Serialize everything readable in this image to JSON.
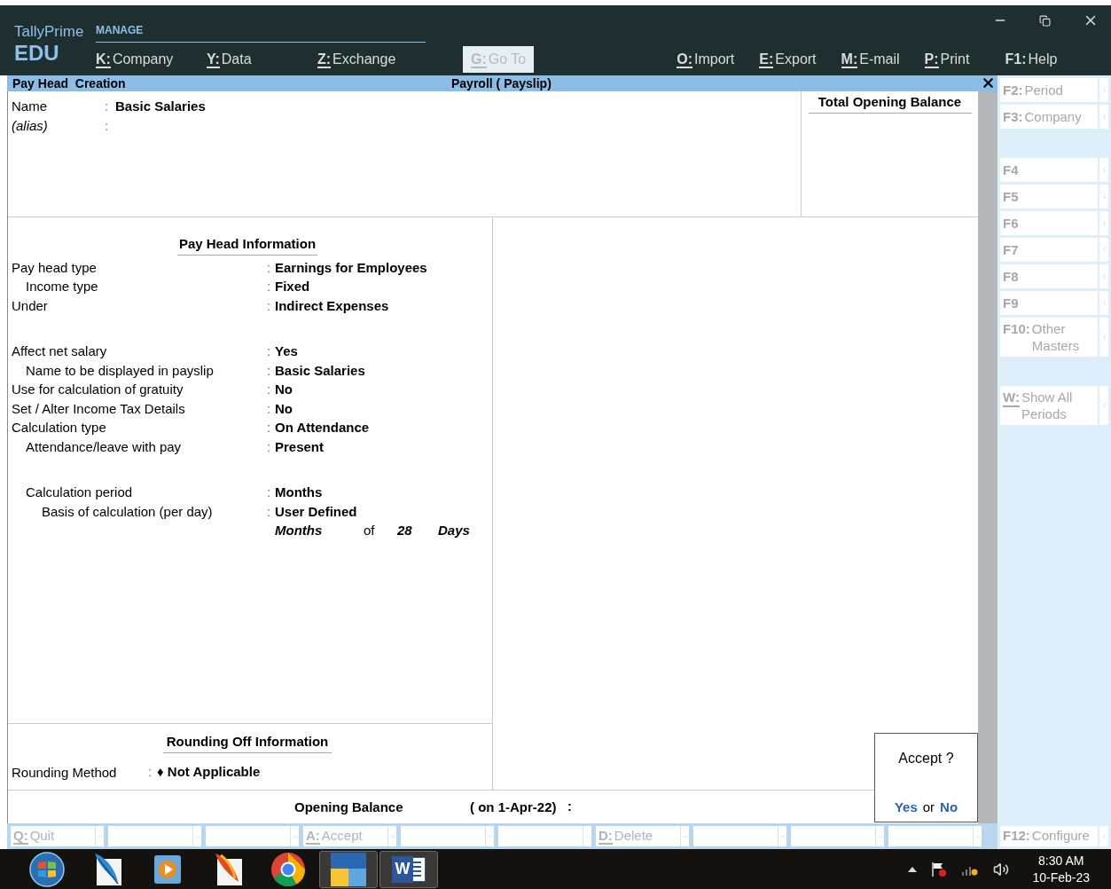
{
  "key_separator": ":",
  "header": {
    "product": "TallyPrime",
    "edition": "EDU",
    "section": "MANAGE",
    "menu_left": [
      {
        "key": "K",
        "label": "Company",
        "underlined": true,
        "disabled": false
      },
      {
        "key": "Y",
        "label": "Data",
        "underlined": true,
        "disabled": false
      },
      {
        "key": "Z",
        "label": "Exchange",
        "underlined": true,
        "disabled": false
      },
      {
        "key": "G",
        "label": "Go To",
        "underlined": true,
        "disabled": true
      }
    ],
    "menu_right": [
      {
        "key": "O",
        "label": "Import",
        "underlined": true,
        "disabled": false
      },
      {
        "key": "E",
        "label": "Export",
        "underlined": true,
        "disabled": false
      },
      {
        "key": "M",
        "label": "E-mail",
        "underlined": true,
        "disabled": false
      },
      {
        "key": "P",
        "label": "Print",
        "underlined": true,
        "disabled": false
      }
    ],
    "help": {
      "key": "F1",
      "label": "Help",
      "underlined": false
    }
  },
  "title_bar": {
    "left": "Pay Head  Creation",
    "center": "Payroll ( Payslip)"
  },
  "master": {
    "fields": [
      {
        "label": "Name",
        "value": "Basic Salaries",
        "italic": false
      },
      {
        "label": "(alias)",
        "italic": true
      }
    ],
    "colon": ":",
    "total_title": "Total Opening Balance"
  },
  "pay_head_info": {
    "title": "Pay Head Information",
    "rows": [
      {
        "label": "Pay head type",
        "value": "Earnings for Employees",
        "gap_before": false,
        "children": [
          {
            "label": "Income type",
            "value": "Fixed",
            "gap_before": false
          }
        ]
      },
      {
        "label": "Under",
        "value": "Indirect Expenses",
        "gap_before": false
      },
      {
        "label": "Affect net salary",
        "value": "Yes",
        "gap_before": true,
        "children": [
          {
            "label": "Name to be displayed in payslip",
            "value": "Basic Salaries",
            "gap_before": false
          }
        ]
      },
      {
        "label": "Use for calculation of gratuity",
        "value": "No",
        "gap_before": false
      },
      {
        "label": "Set / Alter Income Tax Details",
        "value": "No",
        "gap_before": false
      },
      {
        "label": "Calculation type",
        "value": "On Attendance",
        "gap_before": false,
        "children": [
          {
            "label": "Attendance/leave with pay",
            "value": "Present",
            "gap_before": false
          },
          {
            "label": "Calculation period",
            "value": "Months",
            "gap_before": true,
            "children": [
              {
                "label": "Basis of calculation (per day)",
                "value": "User Defined",
                "gap_before": false,
                "detail": {
                  "unit": "Months",
                  "of": "of",
                  "number": "28",
                  "per": "Days"
                }
              }
            ]
          }
        ]
      }
    ]
  },
  "rounding": {
    "title": "Rounding Off Information",
    "label": "Rounding Method",
    "marker": "♦",
    "value": "Not Applicable"
  },
  "opening_balance": {
    "label": "Opening Balance",
    "date": "( on 1-Apr-22)",
    "colon": ":"
  },
  "accept_dialog": {
    "question": "Accept ?",
    "yes": "Yes",
    "or": "or",
    "no": "No"
  },
  "side_button_groups": [
    {
      "buttons": [
        {
          "key": "F2",
          "label": "Period",
          "underlined": false,
          "kind": "short"
        },
        {
          "key": "F3",
          "label": "Company",
          "underlined": false,
          "kind": "short"
        }
      ]
    },
    {
      "buttons": [
        {
          "key": "F4",
          "underlined": false,
          "kind": "short"
        },
        {
          "key": "F5",
          "underlined": false,
          "kind": "short"
        },
        {
          "key": "F6",
          "underlined": false,
          "kind": "short"
        },
        {
          "key": "F7",
          "underlined": false,
          "kind": "short"
        },
        {
          "key": "F8",
          "underlined": false,
          "kind": "short"
        },
        {
          "key": "F9",
          "underlined": false,
          "kind": "short"
        },
        {
          "key": "F10",
          "label": "Other Masters",
          "underlined": false,
          "kind": "tall"
        }
      ]
    },
    {
      "buttons": [
        {
          "key": "W",
          "label": "Show All Periods",
          "underlined": true,
          "kind": "tall"
        }
      ]
    }
  ],
  "bottom_buttons": [
    {
      "kind": "action",
      "key": "Q",
      "label": "Quit"
    },
    {
      "kind": "blank"
    },
    {
      "kind": "blank"
    },
    {
      "kind": "action",
      "key": "A",
      "label": "Accept"
    },
    {
      "kind": "blank"
    },
    {
      "kind": "blank"
    },
    {
      "kind": "action",
      "key": "D",
      "label": "Delete"
    },
    {
      "kind": "blank"
    },
    {
      "kind": "blank"
    },
    {
      "kind": "blank"
    }
  ],
  "configure": {
    "key": "F12",
    "label": "Configure"
  },
  "taskbar": {
    "apps": [
      {
        "kind": "start",
        "selected": false
      },
      {
        "kind": "feather",
        "selected": false
      },
      {
        "kind": "player",
        "selected": false
      },
      {
        "kind": "red_feather",
        "selected": false
      },
      {
        "kind": "ring",
        "selected": false
      },
      {
        "kind": "tiles",
        "selected": true
      },
      {
        "kind": "document",
        "glyph": "W",
        "selected": true
      }
    ],
    "time": "8:30 AM",
    "date": "10-Feb-23"
  }
}
